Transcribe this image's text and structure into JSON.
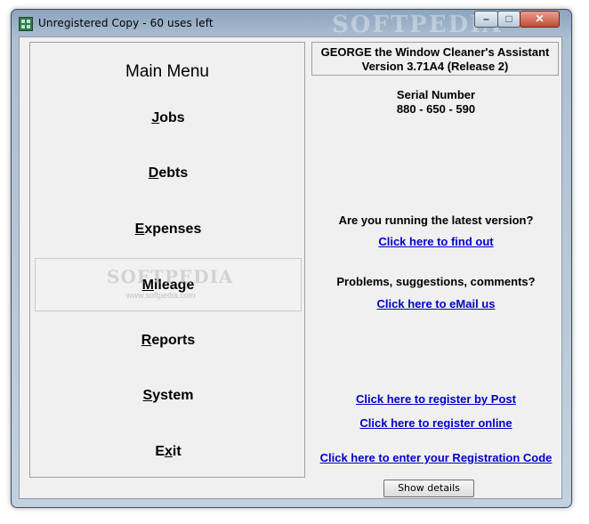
{
  "window": {
    "title": "Unregistered Copy - 60 uses left",
    "watermark": "SOFTPEDIA",
    "controls": {
      "minimize": "–",
      "maximize": "□",
      "close": "✕"
    }
  },
  "menu": {
    "title": "Main Menu",
    "items": [
      {
        "pre": "",
        "key": "J",
        "post": "obs"
      },
      {
        "pre": "",
        "key": "D",
        "post": "ebts"
      },
      {
        "pre": "",
        "key": "E",
        "post": "xpenses"
      },
      {
        "pre": "",
        "key": "M",
        "post": "ileage"
      },
      {
        "pre": "",
        "key": "R",
        "post": "eports"
      },
      {
        "pre": "",
        "key": "S",
        "post": "ystem"
      },
      {
        "pre": "E",
        "key": "x",
        "post": "it"
      }
    ],
    "watermark": "SOFTPEDIA",
    "watermark_url": "www.softpedia.com"
  },
  "info": {
    "line1": "GEORGE the Window Cleaner's Assistant",
    "line2": "Version 3.71A4 (Release 2)",
    "serial_label": "Serial Number",
    "serial_value": "880 - 650 - 590",
    "latest_question": "Are you running the latest version?",
    "latest_link": "Click here to find out",
    "problems_question": "Problems, suggestions, comments?",
    "email_link": "Click here to eMail us",
    "register_post": "Click here to register by Post",
    "register_online": "Click here to register online",
    "register_code": "Click here to enter your Registration Code"
  },
  "buttons": {
    "show_details": "Show details"
  }
}
